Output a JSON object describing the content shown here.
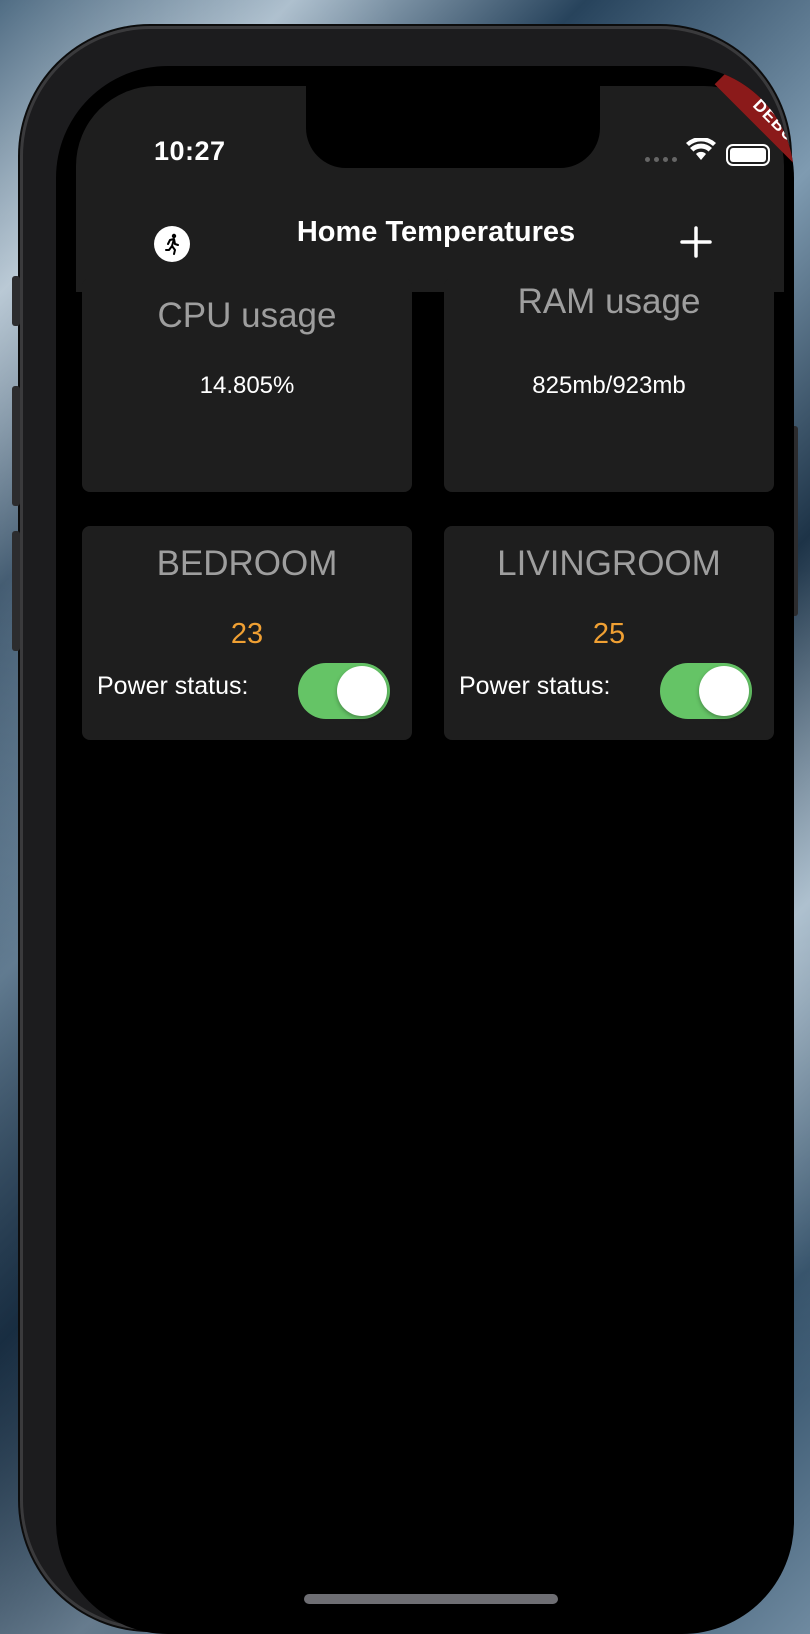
{
  "status_bar": {
    "time": "10:27"
  },
  "debug_banner": "DEBUG",
  "app_bar": {
    "title": "Home Temperatures",
    "leading_icon": "running-person-icon",
    "action_icon": "plus-icon"
  },
  "system_cards": [
    {
      "title": "CPU usage",
      "value": "14.805%"
    },
    {
      "title": "RAM usage",
      "value": "825mb/923mb"
    }
  ],
  "room_cards": [
    {
      "title": "BEDROOM",
      "temperature": "23",
      "power_label": "Power status:",
      "power_on": true
    },
    {
      "title": "LIVINGROOM",
      "temperature": "25",
      "power_label": "Power status:",
      "power_on": true
    }
  ],
  "colors": {
    "card_background": "#1e1e1e",
    "temperature": "#f0a033",
    "switch_on": "#65c466",
    "debug_ribbon": "#8b1a1a"
  }
}
